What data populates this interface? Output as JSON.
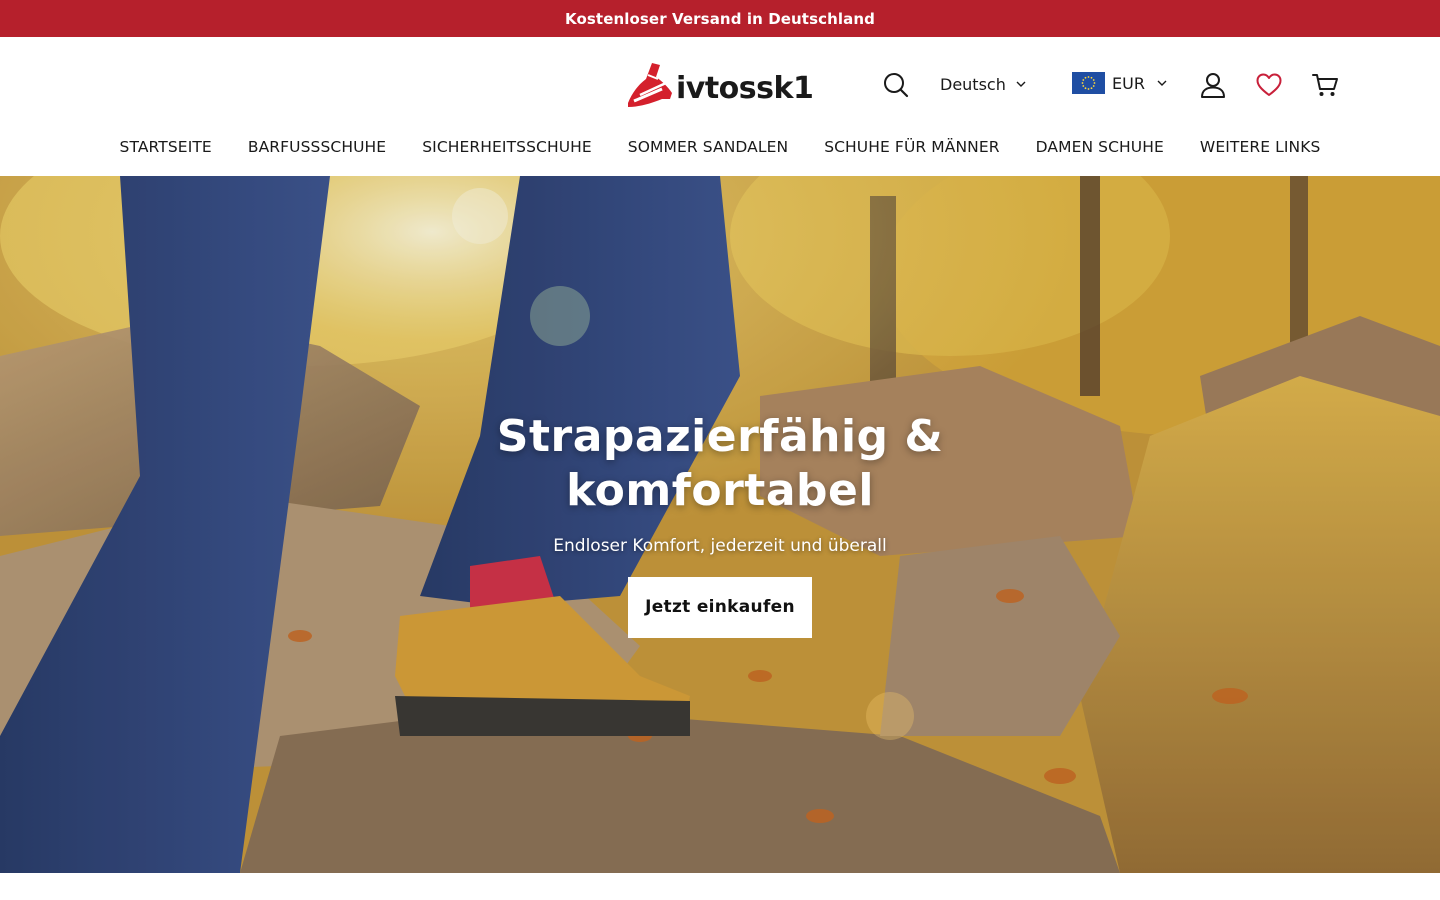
{
  "announcement": {
    "text": "Kostenloser Versand in Deutschland"
  },
  "header": {
    "logo_text": "ivtossk1",
    "language": {
      "selected": "Deutsch"
    },
    "currency": {
      "selected": "EUR",
      "flag": "eu-flag"
    },
    "icons": [
      "search-icon",
      "user-icon",
      "heart-icon",
      "cart-icon"
    ]
  },
  "nav": {
    "items": [
      {
        "label": "STARTSEITE"
      },
      {
        "label": "BARFUSSSCHUHE"
      },
      {
        "label": "SICHERHEITSSCHUHE"
      },
      {
        "label": "SOMMER SANDALEN"
      },
      {
        "label": "SCHUHE FÜR MÄNNER"
      },
      {
        "label": "DAMEN SCHUHE"
      },
      {
        "label": "WEITERE LINKS"
      }
    ]
  },
  "hero": {
    "title": "Strapazierfähig &\nkomfortabel",
    "subtitle": "Endloser Komfort, jederzeit und überall",
    "cta_label": "Jetzt einkaufen"
  },
  "colors": {
    "announcement_bg": "#b6202c",
    "logo_accent": "#d4202c",
    "heart_icon": "#c8203a",
    "eu_flag_blue": "#1f4ea3"
  }
}
